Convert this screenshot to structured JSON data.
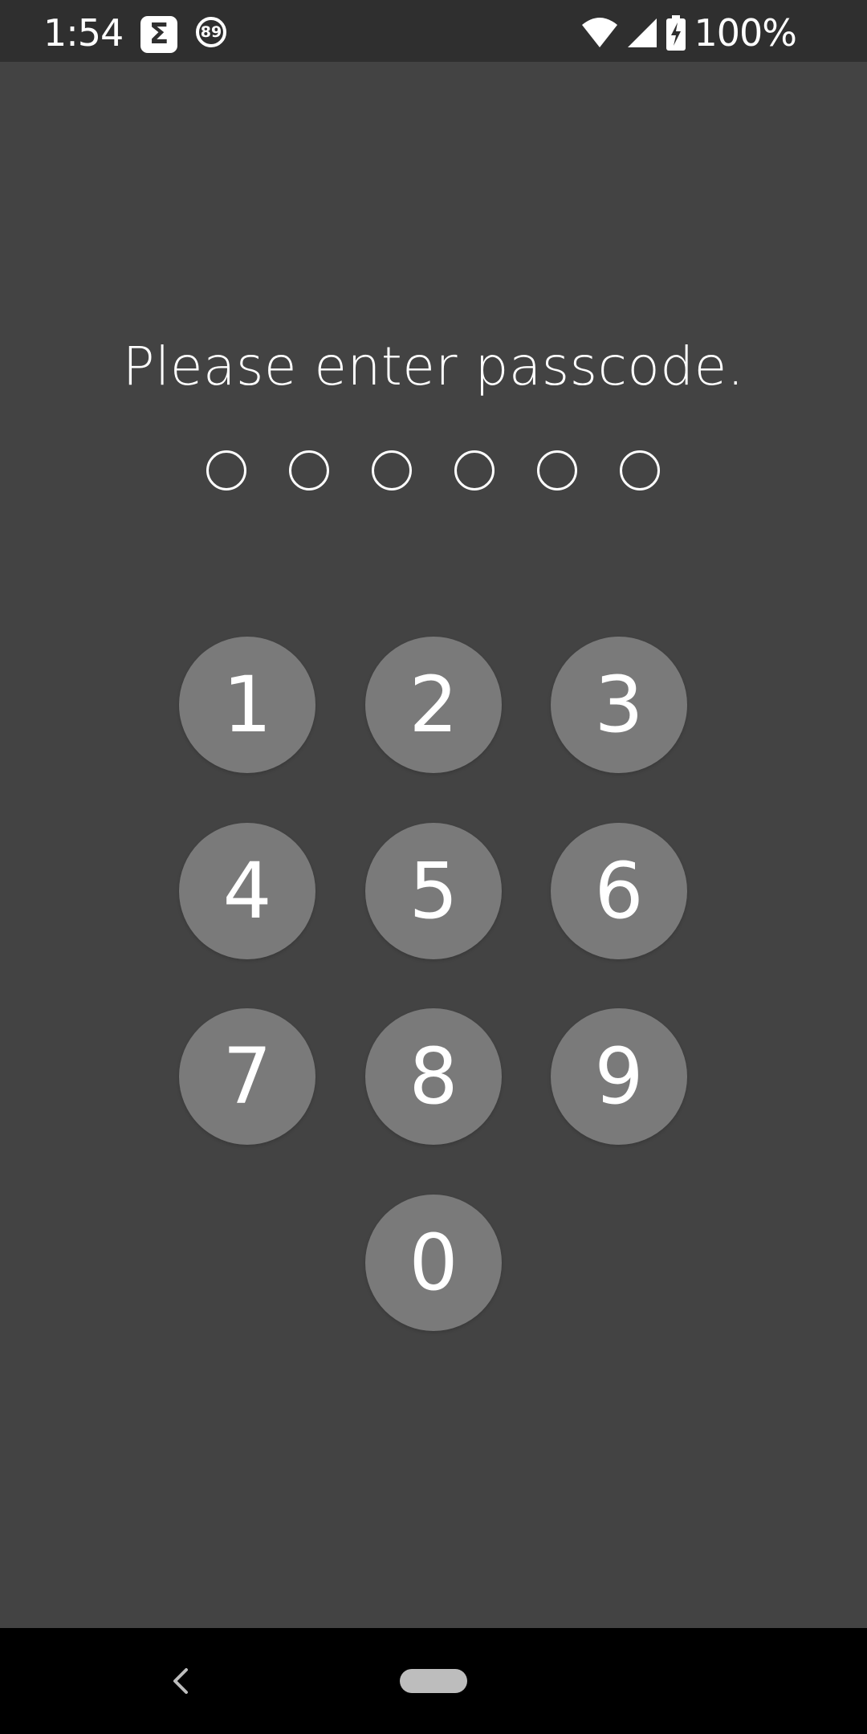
{
  "status_bar": {
    "time": "1:54",
    "app_icon_glyph": "Σ",
    "badge_count": "89",
    "battery": "100%",
    "icons": [
      "sigma-app-icon",
      "counter-badge-icon",
      "wifi-icon",
      "cellular-signal-icon",
      "battery-charging-icon"
    ]
  },
  "lock_screen": {
    "prompt": "Please enter passcode.",
    "passcode_length": 6,
    "filled_digits": 0,
    "keys": [
      "1",
      "2",
      "3",
      "4",
      "5",
      "6",
      "7",
      "8",
      "9",
      "0"
    ]
  },
  "nav_bar": {
    "icons": [
      "back-icon",
      "home-pill-icon"
    ]
  },
  "colors": {
    "background": "#434343",
    "status_bar": "#2f2f2f",
    "key": "#7a7a7a",
    "text": "#ffffff",
    "nav_bar": "#000000"
  }
}
